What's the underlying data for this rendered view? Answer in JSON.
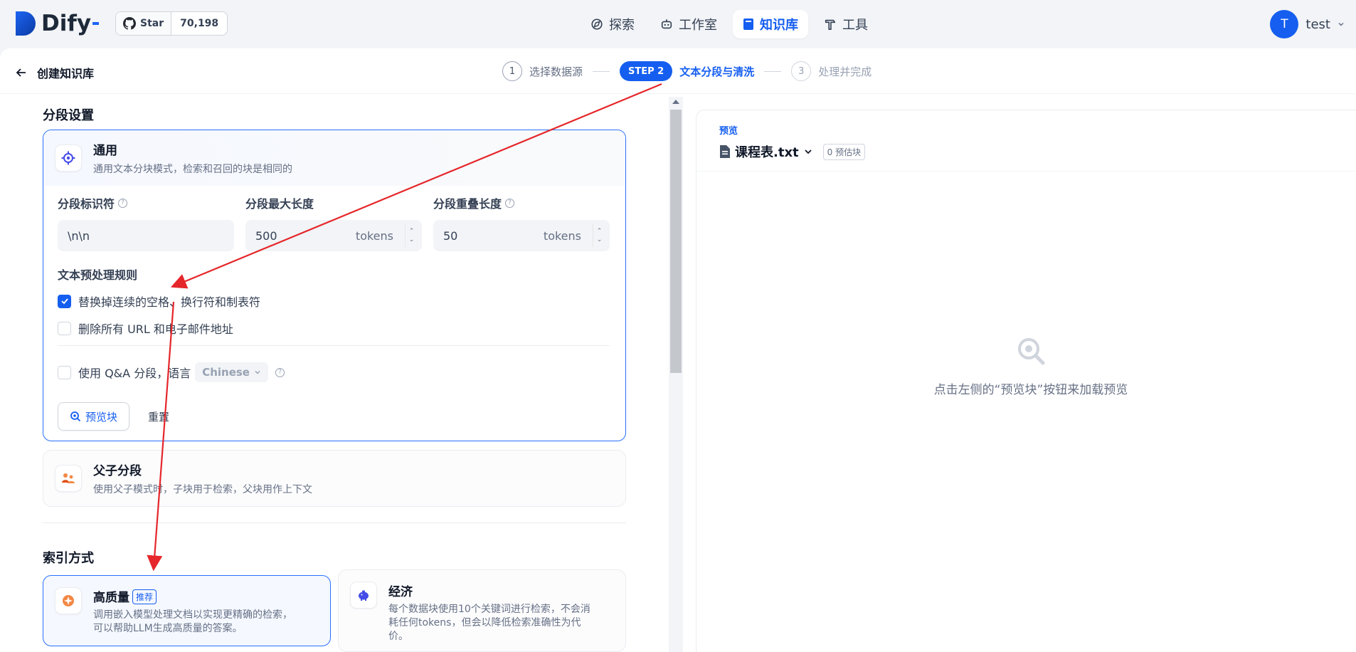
{
  "app": {
    "logo_text": "Dify",
    "github_star_label": "Star",
    "github_star_count": "70,198"
  },
  "nav": {
    "items": [
      {
        "label": "探索",
        "icon": "compass-icon"
      },
      {
        "label": "工作室",
        "icon": "robot-icon"
      },
      {
        "label": "知识库",
        "icon": "book-icon",
        "active": true
      },
      {
        "label": "工具",
        "icon": "hammer-icon"
      }
    ]
  },
  "user": {
    "initial": "T",
    "name": "test"
  },
  "page": {
    "title": "创建知识库"
  },
  "steps": [
    {
      "number": "1",
      "label": "选择数据源"
    },
    {
      "number": "STEP 2",
      "label": "文本分段与清洗",
      "active": true
    },
    {
      "number": "3",
      "label": "处理并完成"
    }
  ],
  "segment": {
    "section_title": "分段设置",
    "general": {
      "title": "通用",
      "desc": "通用文本分块模式，检索和召回的块是相同的"
    },
    "fields": {
      "separator": {
        "label": "分段标识符",
        "value": "\\n\\n"
      },
      "max_length": {
        "label": "分段最大长度",
        "value": "500",
        "unit": "tokens"
      },
      "overlap": {
        "label": "分段重叠长度",
        "value": "50",
        "unit": "tokens"
      }
    },
    "rules": {
      "title": "文本预处理规则",
      "replace_spaces": {
        "label": "替换掉连续的空格、换行符和制表符",
        "checked": true
      },
      "remove_urls": {
        "label": "删除所有 URL 和电子邮件地址",
        "checked": false
      }
    },
    "qa": {
      "label": "使用 Q&A 分段，语言",
      "language": "Chinese",
      "checked": false
    },
    "buttons": {
      "preview": "预览块",
      "reset": "重置"
    },
    "parent_child": {
      "title": "父子分段",
      "desc": "使用父子模式时，子块用于检索，父块用作上下文"
    }
  },
  "index": {
    "section_title": "索引方式",
    "high_quality": {
      "title": "高质量",
      "badge": "推荐",
      "desc_1": "调用嵌入模型处理文档以实现更精确的检索，",
      "desc_2": "可以帮助LLM生成高质量的答案。"
    },
    "economy": {
      "title": "经济",
      "desc_1": "每个数据块使用10个关键词进行检索，不会消",
      "desc_2": "耗任何tokens，但会以降低检索准确性为代",
      "desc_3": "价。"
    }
  },
  "preview": {
    "label": "预览",
    "file_name": "课程表.txt",
    "estimate": "0 预估块",
    "empty_text": "点击左侧的“预览块”按钮来加载预览"
  },
  "colors": {
    "accent": "#155eef",
    "annotation": "#e5262a"
  }
}
